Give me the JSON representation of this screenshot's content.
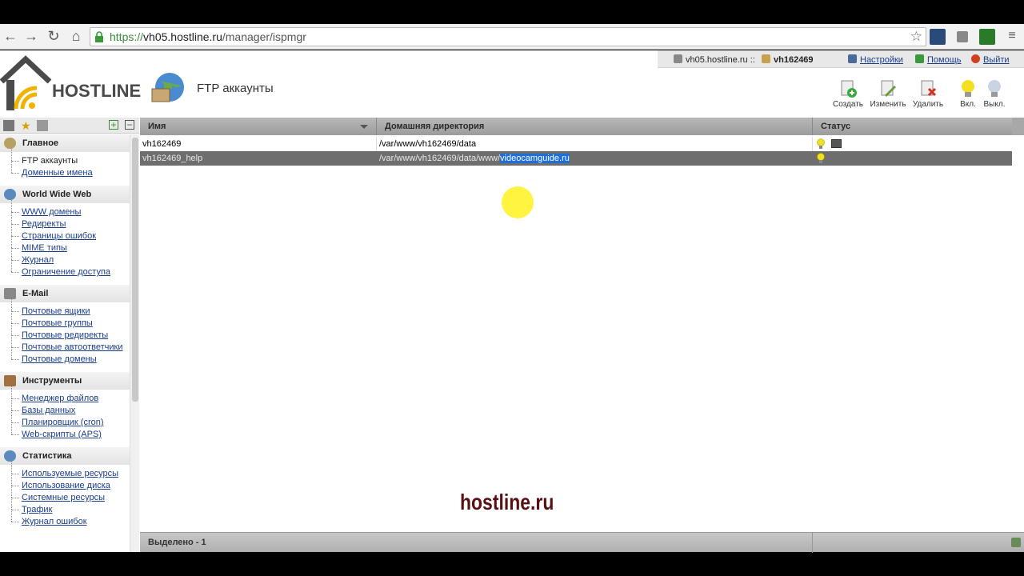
{
  "browser": {
    "url_scheme": "https://",
    "url_host": "vh05.hostline.ru",
    "url_path": "/manager/ispmgr"
  },
  "header": {
    "logo_text": "HOSTLINE",
    "page_title": "FTP аккаунты",
    "server_label": "vh05.hostline.ru ::",
    "user_label": "vh162469",
    "settings_label": "Настройки",
    "help_label": "Помощь",
    "logout_label": "Выйти"
  },
  "toolbar": {
    "create_label": "Создать",
    "edit_label": "Изменить",
    "delete_label": "Удалить",
    "enable_label": "Вкл.",
    "disable_label": "Выкл."
  },
  "sidebar": {
    "groups": [
      {
        "title": "Главное",
        "items": [
          "FTP аккаунты",
          "Доменные имена"
        ]
      },
      {
        "title": "World Wide Web",
        "items": [
          "WWW домены",
          "Редиректы",
          "Страницы ошибок",
          "MIME типы",
          "Журнал",
          "Ограничение доступа"
        ]
      },
      {
        "title": "E-Mail",
        "items": [
          "Почтовые ящики",
          "Почтовые группы",
          "Почтовые редиректы",
          "Почтовые автоответчики",
          "Почтовые домены"
        ]
      },
      {
        "title": "Инструменты",
        "items": [
          "Менеджер файлов",
          "Базы данных",
          "Планировщик (cron)",
          "Web-скрипты (APS)"
        ]
      },
      {
        "title": "Статистика",
        "items": [
          "Используемые ресурсы",
          "Использование диска",
          "Системные ресурсы",
          "Трафик",
          "Журнал ошибок"
        ]
      }
    ]
  },
  "table": {
    "columns": [
      "Имя",
      "Домашняя директория",
      "Статус"
    ],
    "rows": [
      {
        "name": "vh162469",
        "home": "/var/www/vh162469/data",
        "home_suffix": ""
      },
      {
        "name": "vh162469_help",
        "home": "/var/www/vh162469/data/www/",
        "home_suffix": "videocamguide.ru"
      }
    ]
  },
  "footer": {
    "selected_text": "Выделено - 1"
  },
  "watermark": "hostline.ru",
  "colors": {
    "selected_row": "#6e6e6e",
    "link": "#1a3d8a",
    "highlight": "#1e6fd9",
    "watermark": "#5a0f12"
  }
}
